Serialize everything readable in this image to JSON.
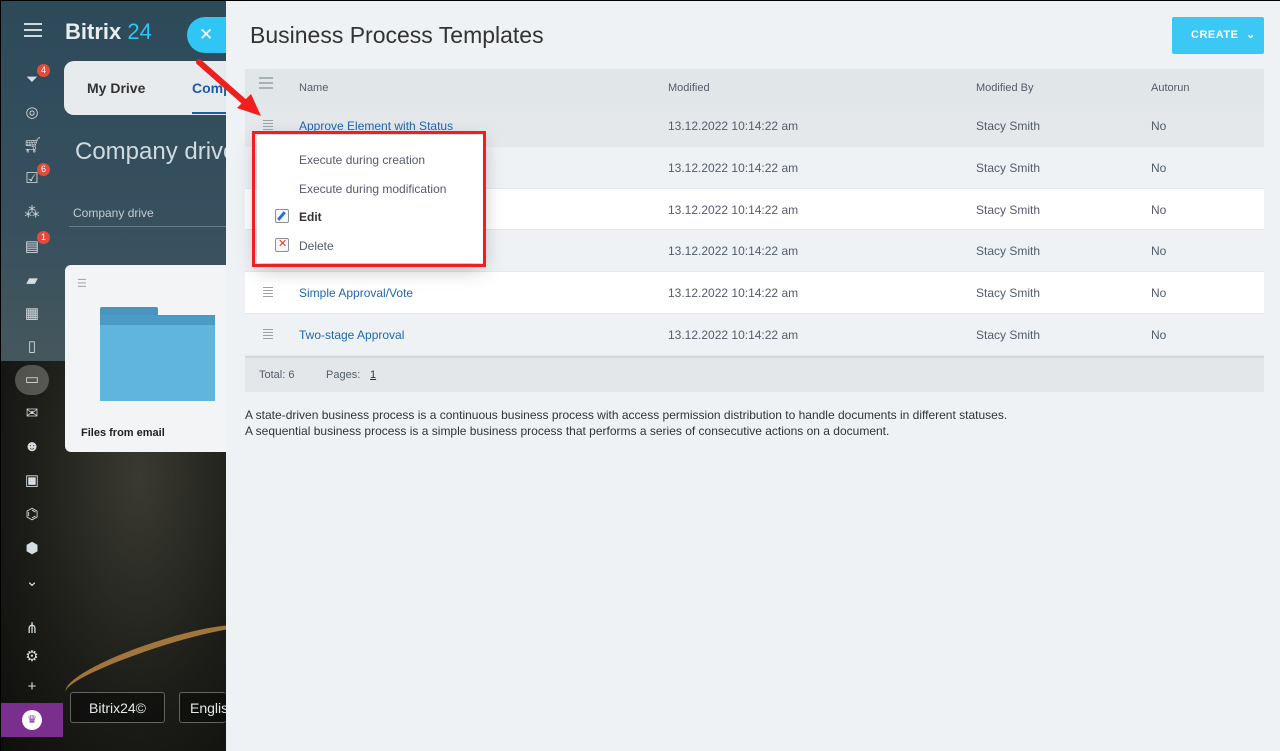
{
  "app": {
    "logo": "Bitrix",
    "logo_num": "24",
    "close_icon": "✕"
  },
  "sidebar": {
    "badges": {
      "filter": "4",
      "tasks": "6",
      "feed": "1"
    }
  },
  "drive": {
    "tab_my": "My Drive",
    "tab_company": "Comp",
    "title": "Company drive",
    "breadcrumb": "Company drive",
    "file_name": "Files from email",
    "footer_brand": "Bitrix24©",
    "footer_lang": "Englis"
  },
  "panel": {
    "title": "Business Process Templates",
    "create_label": "CREATE",
    "columns": {
      "name": "Name",
      "modified": "Modified",
      "modified_by": "Modified By",
      "autorun": "Autorun"
    },
    "rows": [
      {
        "name": "Approve Element with Status",
        "modified": "13.12.2022 10:14:22 am",
        "by": "Stacy Smith",
        "autorun": "No"
      },
      {
        "name": "",
        "modified": "13.12.2022 10:14:22 am",
        "by": "Stacy Smith",
        "autorun": "No"
      },
      {
        "name": "",
        "modified": "13.12.2022 10:14:22 am",
        "by": "Stacy Smith",
        "autorun": "No"
      },
      {
        "name": "",
        "modified": "13.12.2022 10:14:22 am",
        "by": "Stacy Smith",
        "autorun": "No"
      },
      {
        "name": "Simple Approval/Vote",
        "modified": "13.12.2022 10:14:22 am",
        "by": "Stacy Smith",
        "autorun": "No"
      },
      {
        "name": "Two-stage Approval",
        "modified": "13.12.2022 10:14:22 am",
        "by": "Stacy Smith",
        "autorun": "No"
      }
    ],
    "footer": {
      "total": "Total: 6",
      "pages_label": "Pages:",
      "page": "1"
    },
    "description": [
      "A state-driven business process is a continuous business process with access permission distribution to handle documents in different statuses.",
      "A sequential business process is a simple business process that performs a series of consecutive actions on a document."
    ]
  },
  "context_menu": {
    "items": [
      "Execute during creation",
      "Execute during modification",
      "Edit",
      "Delete"
    ]
  }
}
